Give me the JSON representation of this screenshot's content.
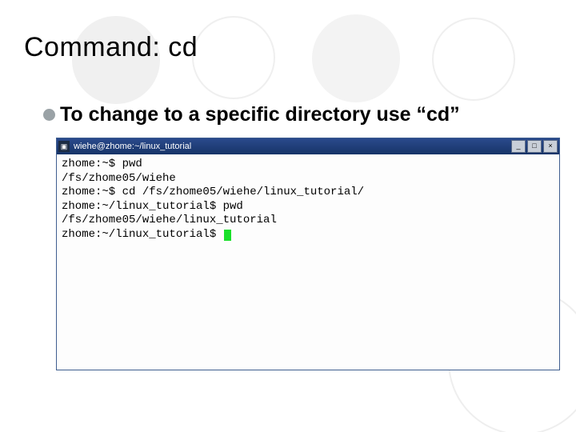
{
  "slide": {
    "title": "Command: cd",
    "bullet": "To change to a specific directory use “cd”"
  },
  "terminal": {
    "title": "wiehe@zhome:~/linux_tutorial",
    "icon_glyph": "▣",
    "buttons": {
      "min": "_",
      "max": "□",
      "close": "×"
    },
    "lines": [
      "zhome:~$ pwd",
      "/fs/zhome05/wiehe",
      "zhome:~$ cd /fs/zhome05/wiehe/linux_tutorial/",
      "zhome:~/linux_tutorial$ pwd",
      "/fs/zhome05/wiehe/linux_tutorial",
      "zhome:~/linux_tutorial$ "
    ]
  }
}
